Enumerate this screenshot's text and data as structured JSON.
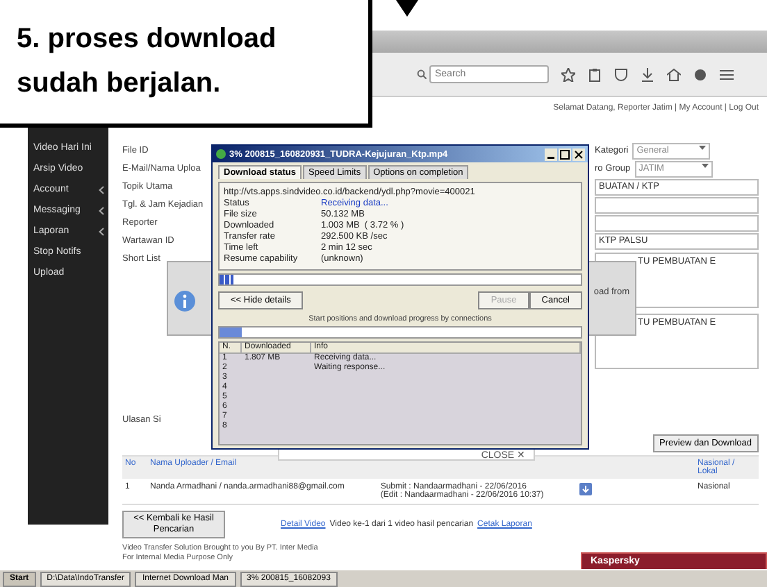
{
  "callout": {
    "text": "5. proses download sudah berjalan."
  },
  "browser": {
    "search_placeholder": "Search",
    "header_text": "Selamat Datang, Reporter Jatim | My Account | Log Out"
  },
  "sidebar": {
    "items": [
      {
        "label": "Video Hari Ini",
        "expandable": false
      },
      {
        "label": "Arsip Video",
        "expandable": false
      },
      {
        "label": "Account",
        "expandable": true
      },
      {
        "label": "Messaging",
        "expandable": true
      },
      {
        "label": "Laporan",
        "expandable": true
      },
      {
        "label": "Stop Notifs",
        "expandable": false
      },
      {
        "label": "Upload",
        "expandable": false
      }
    ]
  },
  "form": {
    "labels": [
      "File ID",
      "E-Mail/Nama Uploa",
      "Topik Utama",
      "Tgl. & Jam Kejadian",
      "Reporter",
      "Wartawan ID",
      "Short List"
    ],
    "ulasan_label": "Ulasan Si",
    "right_fields": [
      {
        "kind": "select",
        "label": "Kategori",
        "value": "General"
      },
      {
        "kind": "select",
        "label": "ro Group",
        "value": "JATIM"
      },
      {
        "kind": "input",
        "value": "BUATAN / KTP"
      },
      {
        "kind": "input"
      },
      {
        "kind": "input"
      },
      {
        "kind": "input",
        "value": "KTP PALSU"
      },
      {
        "kind": "textarea",
        "value": "TU PEMBUATAN E"
      },
      {
        "kind": "textarea",
        "value": "TU PEMBUATAN E"
      }
    ],
    "preview_button": "Preview dan Download"
  },
  "table": {
    "columns": [
      "No",
      "Nama Uploader / Email",
      "Nasional / Lokal"
    ],
    "rows": [
      {
        "no": "1",
        "uploader": "Nanda Armadhani / nanda.armadhani88@gmail.com",
        "submit": "Submit : Nandaarmadhani - 22/06/2016",
        "edit": "(Edit : Nandaarmadhani - 22/06/2016 10:37)",
        "scope": "Nasional"
      }
    ]
  },
  "back_button": "<< Kembali ke Hasil Pencarian",
  "links_line": {
    "prefix": "Detail Video",
    "text": "Video ke-1 dari 1 video hasil pencarian",
    "suffix": "Cetak Laporan"
  },
  "footer": [
    "Video Transfer Solution Brought to you By PT. Inter Media",
    "For Internal Media Purpose Only"
  ],
  "info_popup": {
    "side_text": "oad from",
    "close": "CLOSE ✕"
  },
  "download_dialog": {
    "title": "3% 200815_160820931_TUDRA-Kejujuran_Ktp.mp4",
    "tabs": [
      {
        "label": "Download status",
        "selected": true
      },
      {
        "label": "Speed Limits",
        "selected": false
      },
      {
        "label": "Options on completion",
        "selected": false
      }
    ],
    "url": "http://vts.apps.sindvideo.co.id/backend/ydl.php?movie=400021",
    "status_label": "Status",
    "status": "Receiving data...",
    "details": [
      {
        "label": "File size",
        "value": "50.132 MB"
      },
      {
        "label": "Downloaded",
        "value": "1.003 MB  ( 3.72 % )"
      },
      {
        "label": "Transfer rate",
        "value": "292.500 KB /sec"
      },
      {
        "label": "Time left",
        "value": "2 min 12 sec"
      },
      {
        "label": "Resume capability",
        "value": "(unknown)"
      }
    ],
    "progress": {
      "level": 0.037
    },
    "buttons": [
      {
        "label": "<< Hide details",
        "disabled": false
      },
      {
        "label": "Pause",
        "disabled": true
      },
      {
        "label": "Cancel",
        "disabled": false
      }
    ],
    "note": "Start positions and download progress by connections",
    "connection_progress": {
      "level": 0.06
    },
    "columns": [
      "N.",
      "Downloaded",
      "Info"
    ],
    "rows": [
      {
        "n": "1",
        "downloaded": "1.807 MB",
        "info": "Receiving data..."
      },
      {
        "n": "2",
        "info": "Waiting response..."
      },
      {
        "n": "3"
      },
      {
        "n": "4"
      },
      {
        "n": "5"
      },
      {
        "n": "6"
      },
      {
        "n": "7"
      },
      {
        "n": "8"
      }
    ]
  },
  "notification": {
    "text": "Kaspersky"
  },
  "taskbar": {
    "items": [
      "Start",
      "D:\\Data\\IndoTransfer",
      "Internet Download Man",
      "3% 200815_16082093"
    ]
  }
}
